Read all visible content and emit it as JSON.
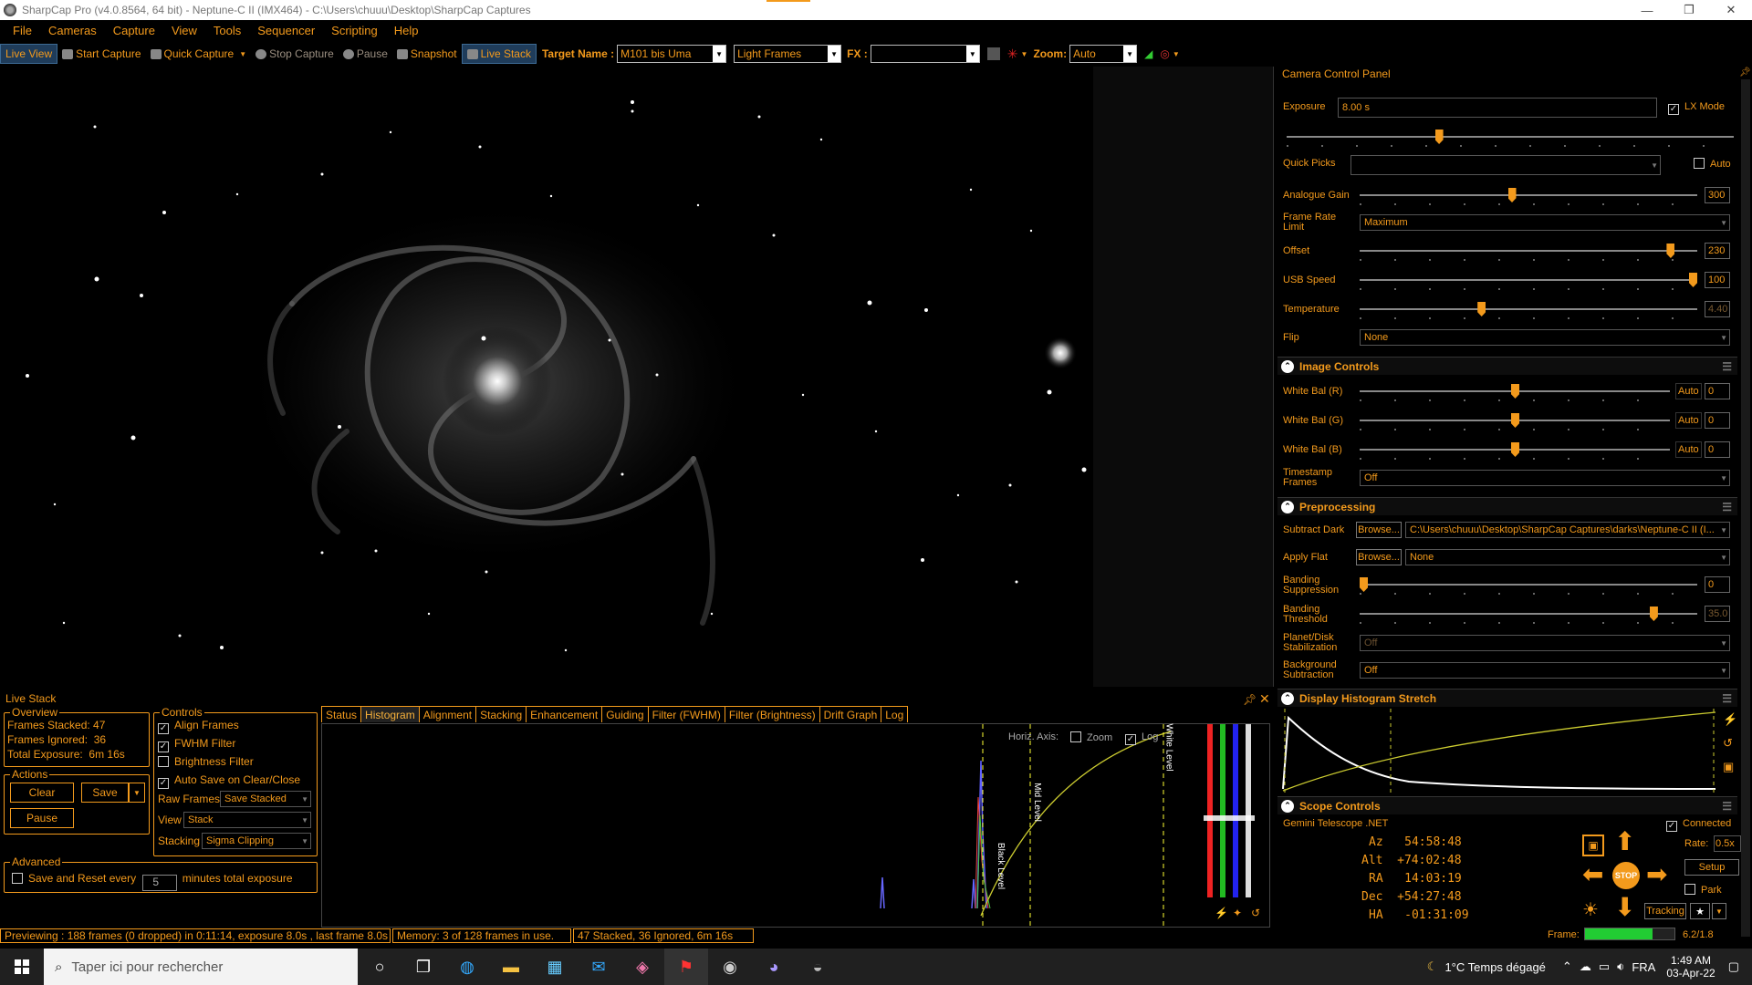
{
  "window": {
    "title": "SharpCap Pro (v4.0.8564, 64 bit) - Neptune-C II (IMX464) - C:\\Users\\chuuu\\Desktop\\SharpCap Captures",
    "buttons": [
      "—",
      "❐",
      "✕"
    ]
  },
  "menu": [
    "File",
    "Cameras",
    "Capture",
    "View",
    "Tools",
    "Sequencer",
    "Scripting",
    "Help"
  ],
  "toolbar": {
    "live_view": "Live View",
    "start_capture": "Start Capture",
    "quick_capture": "Quick Capture",
    "stop_capture": "Stop Capture",
    "pause": "Pause",
    "snapshot": "Snapshot",
    "live_stack": "Live Stack",
    "target_name_label": "Target Name :",
    "target_name_value": "M101 bis Uma",
    "frame_type_value": "Light Frames",
    "fx_label": "FX :",
    "fx_value": "",
    "zoom_label": "Zoom:",
    "zoom_value": "Auto"
  },
  "live_stack": {
    "title": "Live Stack",
    "overview_title": "Overview",
    "frames_stacked_label": "Frames Stacked:",
    "frames_stacked": "47",
    "frames_ignored_label": "Frames Ignored:",
    "frames_ignored": "36",
    "total_exposure_label": "Total Exposure:",
    "total_exposure": "6m 16s",
    "actions_title": "Actions",
    "clear": "Clear",
    "save": "Save",
    "pause": "Pause",
    "advanced_title": "Advanced",
    "save_reset_label": "Save and Reset every",
    "save_reset_value": "5",
    "save_reset_suffix": "minutes total exposure",
    "controls_title": "Controls",
    "align_frames": "Align Frames",
    "fwhm_filter": "FWHM Filter",
    "brightness_filter": "Brightness Filter",
    "auto_save": "Auto Save on Clear/Close",
    "raw_frames_label": "Raw Frames",
    "raw_frames_value": "Save Stacked",
    "view_label": "View",
    "view_value": "Stack",
    "stacking_label": "Stacking",
    "stacking_value": "Sigma Clipping",
    "tabs": [
      "Status",
      "Histogram",
      "Alignment",
      "Stacking",
      "Enhancement",
      "Guiding",
      "Filter (FWHM)",
      "Filter (Brightness)",
      "Drift Graph",
      "Log"
    ],
    "horiz_axis_label": "Horiz. Axis:",
    "zoom_label": "Zoom",
    "log_label": "Log",
    "black_level": "Black Level",
    "mid_level": "Mid Level",
    "white_level": "White Level"
  },
  "status_bar": {
    "preview": "Previewing : 188 frames (0 dropped) in 0:11:14, exposure 8.0s , last frame 8.0s",
    "memory": "Memory: 3 of 128 frames in use.",
    "stack": "47 Stacked, 36 Ignored, 6m 16s"
  },
  "camera_panel": {
    "title": "Camera Control Panel",
    "exposure_label": "Exposure",
    "exposure_value": "8.00 s",
    "lx_mode": "LX Mode",
    "quick_picks_label": "Quick Picks",
    "auto_label": "Auto",
    "analogue_gain_label": "Analogue Gain",
    "analogue_gain": "300",
    "analogue_gain_level": 0.45,
    "frame_rate_label": "Frame Rate Limit",
    "frame_rate_value": "Maximum",
    "offset_label": "Offset",
    "offset": "230",
    "offset_level": 0.92,
    "usb_speed_label": "USB Speed",
    "usb_speed": "100",
    "usb_speed_level": 1.0,
    "temperature_label": "Temperature",
    "temperature": "4.40",
    "temperature_level": 0.36,
    "flip_label": "Flip",
    "flip_value": "None",
    "exposure_level": 0.34
  },
  "image_controls": {
    "title": "Image Controls",
    "wb_r_label": "White Bal (R)",
    "wb_g_label": "White Bal (G)",
    "wb_b_label": "White Bal (B)",
    "auto": "Auto",
    "wb_value": "0",
    "wb_level": 0.5,
    "timestamp_label": "Timestamp Frames",
    "timestamp_value": "Off"
  },
  "preprocessing": {
    "title": "Preprocessing",
    "subtract_dark_label": "Subtract Dark",
    "browse": "Browse...",
    "subtract_dark_value": "C:\\Users\\chuuu\\Desktop\\SharpCap Captures\\darks\\Neptune-C II (I...",
    "apply_flat_label": "Apply Flat",
    "apply_flat_value": "None",
    "banding_suppression_label": "Banding Suppression",
    "banding_suppression": "0",
    "banding_threshold_label": "Banding Threshold",
    "banding_threshold": "35.0",
    "banding_threshold_level": 0.87,
    "planet_label": "Planet/Disk Stabilization",
    "planet_value": "Off",
    "background_label": "Background Subtraction",
    "background_value": "Off"
  },
  "histogram_stretch": {
    "title": "Display Histogram Stretch"
  },
  "scope": {
    "title": "Scope Controls",
    "connected": "Connected",
    "mount": "Gemini Telescope .NET",
    "az_label": "Az",
    "az": "54:58:48",
    "alt_label": "Alt",
    "alt": "+74:02:48",
    "ra_label": "RA",
    "ra": "14:03:19",
    "dec_label": "Dec",
    "dec": "+54:27:48",
    "ha_label": "HA",
    "ha": "-01:31:09",
    "stop": "STOP",
    "rate_label": "Rate:",
    "rate_value": "0.5x",
    "setup": "Setup",
    "park": "Park",
    "tracking": "Tracking",
    "frame_label": "Frame:",
    "frame_value": "6.2/1.8",
    "frame_level": 0.75
  },
  "taskbar": {
    "search_placeholder": "Taper ici pour rechercher",
    "weather": "1°C  Temps dégagé",
    "lang": "FRA",
    "time": "1:49 AM",
    "date": "03-Apr-22"
  },
  "colors": {
    "accent": "#f39a1c",
    "background": "#000000",
    "selected_tab": "#1f3c5a"
  }
}
